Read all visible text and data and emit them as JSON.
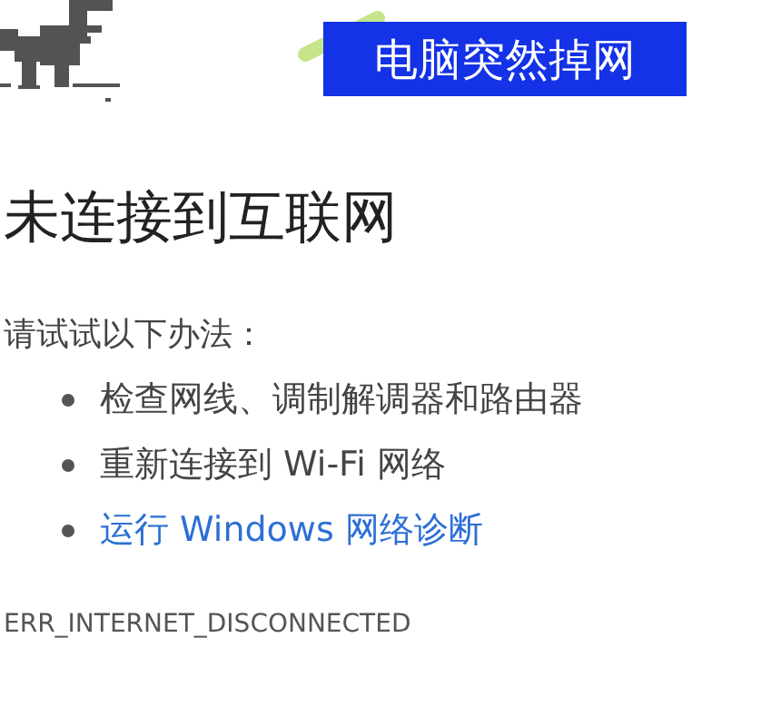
{
  "caption": "电脑突然掉网",
  "heading": "未连接到互联网",
  "suggestions": {
    "intro": "请试试以下办法：",
    "items": [
      {
        "text": "检查网线、调制解调器和路由器",
        "kind": "text"
      },
      {
        "text": "重新连接到 Wi-Fi 网络",
        "kind": "text"
      },
      {
        "text": "运行 Windows 网络诊断",
        "kind": "link"
      }
    ]
  },
  "error_code": "ERR_INTERNET_DISCONNECTED"
}
